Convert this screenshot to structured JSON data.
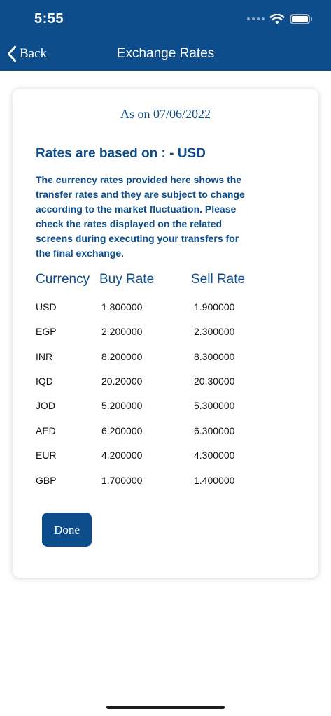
{
  "status_bar": {
    "time": "5:55"
  },
  "nav": {
    "back_label": "Back",
    "title": "Exchange Rates"
  },
  "card": {
    "as_on": "As on 07/06/2022",
    "based_on": "Rates are based on :  - USD",
    "disclaimer": "The currency rates provided here shows the transfer rates and they are subject to change according to the market fluctuation. Please check the rates displayed on the related screens during executing your transfers for the final exchange.",
    "table": {
      "headers": {
        "currency": "Currency",
        "buy": "Buy Rate",
        "sell": "Sell Rate"
      },
      "rows": [
        {
          "currency": "USD",
          "buy": "1.800000",
          "sell": "1.900000"
        },
        {
          "currency": "EGP",
          "buy": "2.200000",
          "sell": "2.300000"
        },
        {
          "currency": "INR",
          "buy": "8.200000",
          "sell": "8.300000"
        },
        {
          "currency": "IQD",
          "buy": "20.20000",
          "sell": "20.30000"
        },
        {
          "currency": "JOD",
          "buy": "5.200000",
          "sell": "5.300000"
        },
        {
          "currency": "AED",
          "buy": "6.200000",
          "sell": "6.300000"
        },
        {
          "currency": "EUR",
          "buy": "4.200000",
          "sell": "4.300000"
        },
        {
          "currency": "GBP",
          "buy": "1.700000",
          "sell": "1.400000"
        }
      ]
    },
    "done_label": "Done"
  },
  "colors": {
    "brand": "#0d4d8c",
    "background": "#ffffff",
    "text": "#111111"
  },
  "icons": {
    "back": "chevron-left-icon",
    "wifi": "wifi-icon",
    "battery": "battery-icon",
    "signal": "signal-icon"
  }
}
